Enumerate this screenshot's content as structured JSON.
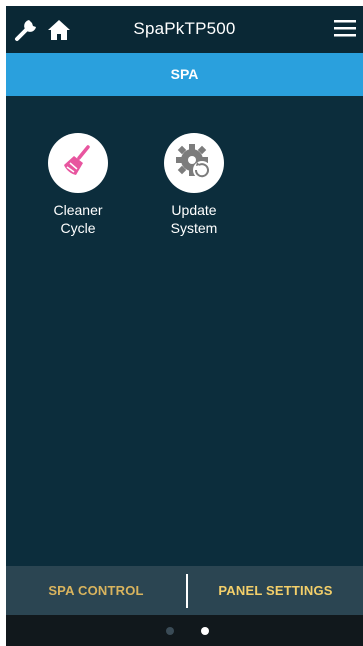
{
  "header": {
    "title": "SpaPkTP500",
    "icons": [
      "wrench-icon",
      "home-icon",
      "hamburger-menu-icon"
    ]
  },
  "section": {
    "label": "SPA"
  },
  "tiles": [
    {
      "label": "Cleaner\nCycle",
      "icon": "broom-icon",
      "icon_color": "#e8559f"
    },
    {
      "label": "Update\nSystem",
      "icon": "gear-update-icon",
      "icon_color": "#7c7c7c"
    }
  ],
  "bottom_tabs": [
    {
      "label": "SPA CONTROL"
    },
    {
      "label": "PANEL SETTINGS"
    }
  ],
  "pager": {
    "page_count": 2,
    "active_page": 2
  },
  "colors": {
    "background": "#0c2d3c",
    "accent": "#2aa0dd",
    "tab_text": "#f3cf6a"
  }
}
